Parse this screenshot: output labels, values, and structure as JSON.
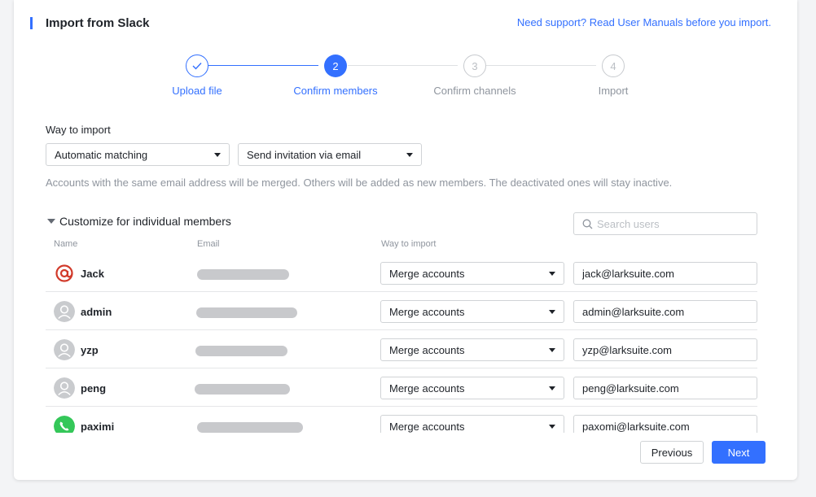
{
  "header": {
    "title": "Import from Slack",
    "support_link": "Need support? Read User Manuals before you import."
  },
  "steps": [
    {
      "label": "Upload file",
      "status": "done",
      "marker": "✓"
    },
    {
      "label": "Confirm members",
      "status": "active",
      "marker": "2"
    },
    {
      "label": "Confirm channels",
      "status": "pending",
      "marker": "3"
    },
    {
      "label": "Import",
      "status": "pending",
      "marker": "4"
    }
  ],
  "import_options": {
    "label": "Way to import",
    "matching_select": "Automatic matching",
    "invitation_select": "Send invitation via email",
    "hint": "Accounts with the same email address will be merged. Others will be added as new members. The deactivated ones will stay inactive."
  },
  "customize": {
    "title": "Customize for individual members",
    "search_placeholder": "Search users",
    "columns": {
      "name": "Name",
      "email": "Email",
      "way": "Way to import"
    }
  },
  "members": [
    {
      "name": "Jack",
      "avatar": "at-sign-avatar",
      "way": "Merge accounts",
      "target_email": "jack@larksuite.com"
    },
    {
      "name": "admin",
      "avatar": "default-user-avatar",
      "way": "Merge accounts",
      "target_email": "admin@larksuite.com"
    },
    {
      "name": "yzp",
      "avatar": "default-user-avatar",
      "way": "Merge accounts",
      "target_email": "yzp@larksuite.com"
    },
    {
      "name": "peng",
      "avatar": "default-user-avatar",
      "way": "Merge accounts",
      "target_email": "peng@larksuite.com"
    },
    {
      "name": "paximi",
      "avatar": "phone-avatar",
      "way": "Merge accounts",
      "target_email": "paxomi@larksuite.com"
    }
  ],
  "footer": {
    "previous_label": "Previous",
    "next_label": "Next"
  },
  "colors": {
    "accent": "#3370ff",
    "text": "#1f2329",
    "muted": "#8f959e",
    "border": "#d0d3d6",
    "at_sign": "#d13a2a",
    "phone_green": "#34c759"
  }
}
